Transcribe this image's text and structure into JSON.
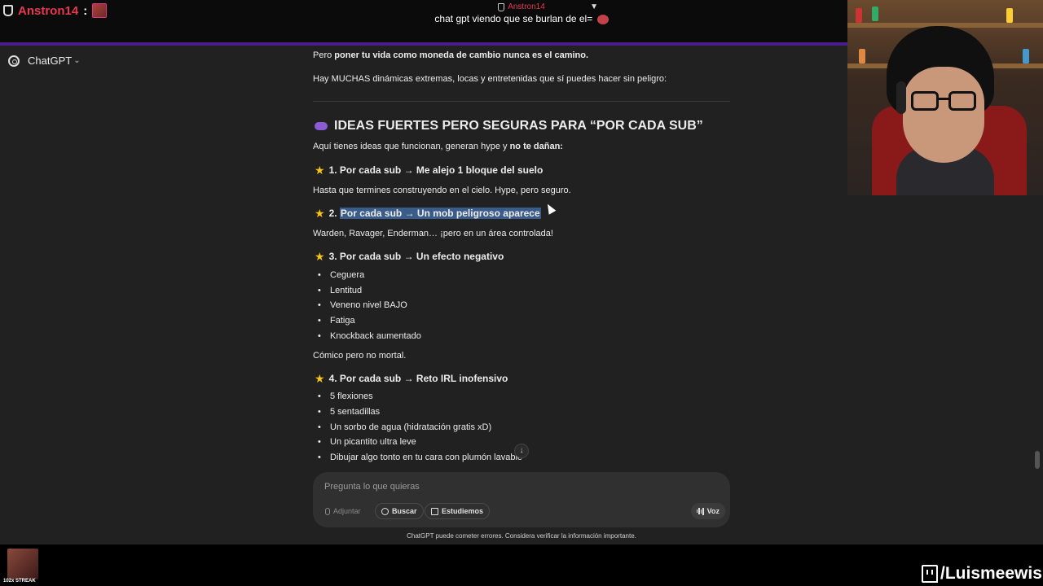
{
  "overlay": {
    "chat_user": "Anstron14",
    "chat_colon": ":",
    "pinned_user": "Anstron14",
    "pinned_message": "chat gpt viendo que se burlan de el= ",
    "channel": "/Luismeewis",
    "streak": "102x STREAK"
  },
  "app": {
    "title": "ChatGPT",
    "title_chevron": "⌄"
  },
  "message": {
    "p1_prefix": "Pero ",
    "p1_bold": "poner tu vida como moneda de cambio nunca es el camino.",
    "p2": "Hay MUCHAS dinámicas extremas, locas y entretenidas que sí puedes hacer sin peligro:",
    "heading": "IDEAS FUERTES PERO SEGURAS PARA “POR CADA SUB”",
    "intro_prefix": "Aquí tienes ideas que funcionan, generan hype y ",
    "intro_bold": "no te dañan:",
    "idea1_title": "1. Por cada sub → Me alejo 1 bloque del suelo",
    "idea1_text": "Hasta que termines construyendo en el cielo. Hype, pero seguro.",
    "idea2_prefix": "2. ",
    "idea2_title": "Por cada sub → Un mob peligroso aparece",
    "idea2_text": "Warden, Ravager, Enderman… ¡pero en un área controlada!",
    "idea3_title": "3. Por cada sub → Un efecto negativo",
    "idea3_items": [
      "Ceguera",
      "Lentitud",
      "Veneno nivel BAJO",
      "Fatiga",
      "Knockback aumentado"
    ],
    "idea3_text": "Cómico pero no mortal.",
    "idea4_title": "4. Por cada sub → Reto IRL inofensivo",
    "idea4_items": [
      "5 flexiones",
      "5 sentadillas",
      "Un sorbo de agua (hidratación gratis xD)",
      "Un picantito ultra leve",
      "Dibujar algo tonto en tu cara con plumón lavable"
    ]
  },
  "composer": {
    "placeholder": "Pregunta lo que quieras",
    "attach": "Adjuntar",
    "search": "Buscar",
    "study": "Estudiemos",
    "voice": "Voz"
  },
  "disclaimer": "ChatGPT puede cometer errores. Considera verificar la información importante.",
  "icons": {
    "scroll_down": "↓",
    "star": "★",
    "pin": "📌"
  }
}
